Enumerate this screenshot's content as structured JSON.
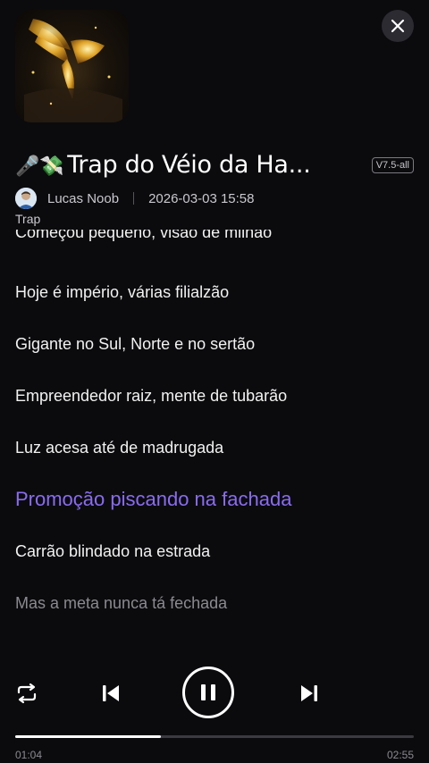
{
  "track": {
    "emoji": "🎤💸",
    "title": "Trap do Véio da Ha...",
    "version": "V7.5-all",
    "author": "Lucas Noob",
    "date": "2026-03-03 15:58",
    "genre": "Trap"
  },
  "lyrics": [
    {
      "text": "Começou pequeno, visão de milhão",
      "state": "partial"
    },
    {
      "text": "Hoje é império, várias filialzão",
      "state": "normal"
    },
    {
      "text": "Gigante no Sul, Norte e no sertão",
      "state": "normal"
    },
    {
      "text": "Empreendedor raiz, mente de tubarão",
      "state": "normal"
    },
    {
      "text": "Luz acesa até de madrugada",
      "state": "normal"
    },
    {
      "text": "Promoção piscando na fachada",
      "state": "active"
    },
    {
      "text": "Carrão blindado na estrada",
      "state": "normal"
    },
    {
      "text": "Mas a meta nunca tá fechada",
      "state": "dim"
    }
  ],
  "player": {
    "current_time": "01:04",
    "duration": "02:55",
    "progress": 0.365,
    "state": "playing"
  },
  "icons": {
    "close": "close-icon",
    "repeat": "repeat-icon",
    "previous": "skip-previous-icon",
    "pause": "pause-icon",
    "next": "skip-next-icon"
  },
  "colors": {
    "background": "#0b0b0e",
    "accent": "#8a6cf0"
  }
}
